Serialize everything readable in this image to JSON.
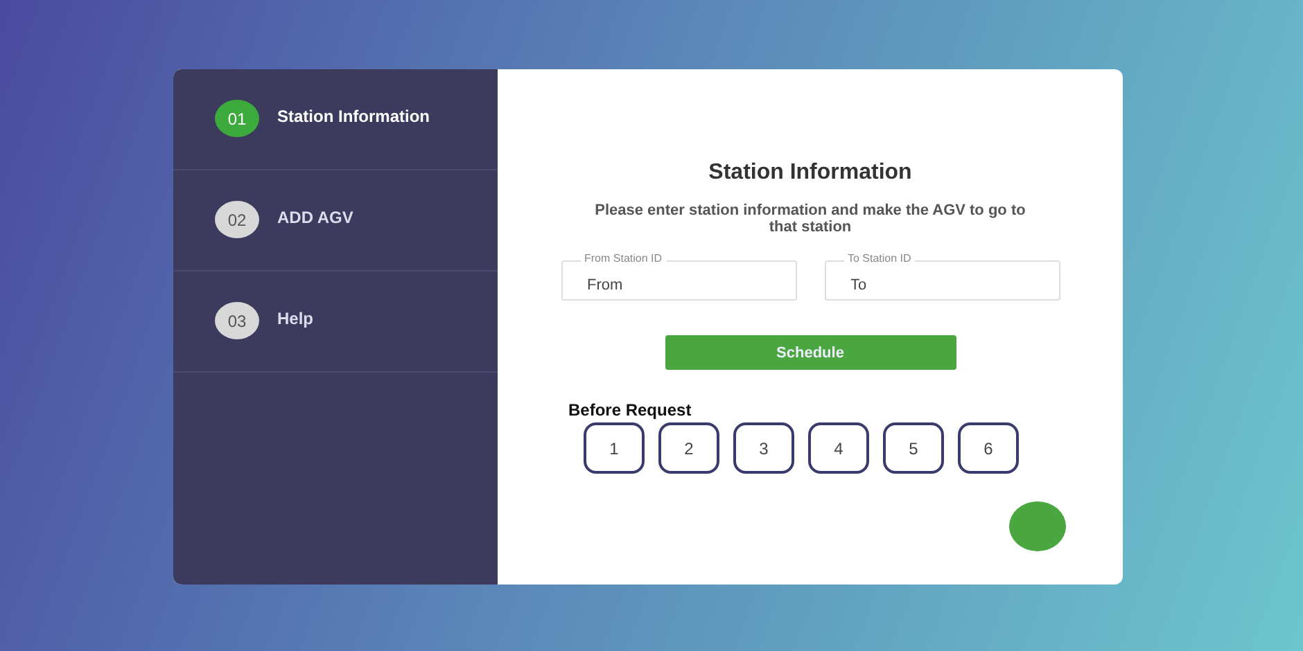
{
  "steps": [
    {
      "number": "01",
      "label": "Station Information",
      "selected": true
    },
    {
      "number": "02",
      "label": "ADD AGV",
      "selected": false
    },
    {
      "number": "03",
      "label": "Help",
      "selected": false
    }
  ],
  "form": {
    "title": "Station Information",
    "description": "Please enter station information and make the AGV to go to that station",
    "fields": [
      {
        "label": "From Station ID",
        "value": "From"
      },
      {
        "label": "To Station ID",
        "value": "To"
      }
    ],
    "button": "Schedule",
    "stations_label": "Before Request",
    "stations": [
      "1",
      "2",
      "3",
      "4",
      "5",
      "6"
    ]
  }
}
